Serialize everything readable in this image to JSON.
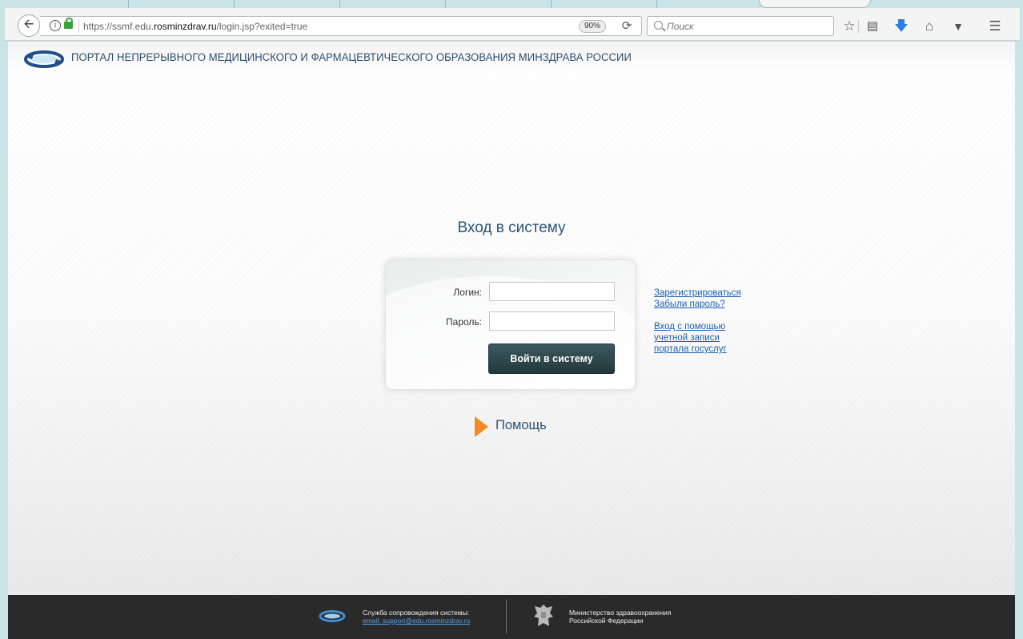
{
  "browser": {
    "url_prefix": "https://ssmf.edu.",
    "url_domain": "rosminzdrav.ru",
    "url_path": "/login.jsp?exited=true",
    "zoom": "90%",
    "search_placeholder": "Поиск"
  },
  "header": {
    "portal_title": "ПОРТАЛ НЕПРЕРЫВНОГО МЕДИЦИНСКОГО И ФАРМАЦЕВТИЧЕСКОГО ОБРАЗОВАНИЯ МИНЗДРАВА РОССИИ"
  },
  "login": {
    "heading": "Вход в систему",
    "login_label": "Логин:",
    "login_value": "",
    "password_label": "Пароль:",
    "password_value": "",
    "submit_label": "Войти в систему"
  },
  "links": {
    "register": "Зарегистрироваться",
    "forgot_password": "Забыли пароль?",
    "gosuslugi_line1": "Вход с помощью",
    "gosuslugi_line2": "учетной записи",
    "gosuslugi_line3": "портала госуслуг"
  },
  "help": {
    "label": "Помощь"
  },
  "footer": {
    "support_title": "Служба сопровождения системы:",
    "support_email": "email: support@edu.rosminzdrav.ru",
    "ministry_line1": "Министерство здравоохранения",
    "ministry_line2": "Российской Федерации"
  },
  "colors": {
    "accent_orange": "#f08a24",
    "title_blue": "#2c5578",
    "button_dark": "#2c4649",
    "link_blue": "#1a5fb4"
  }
}
